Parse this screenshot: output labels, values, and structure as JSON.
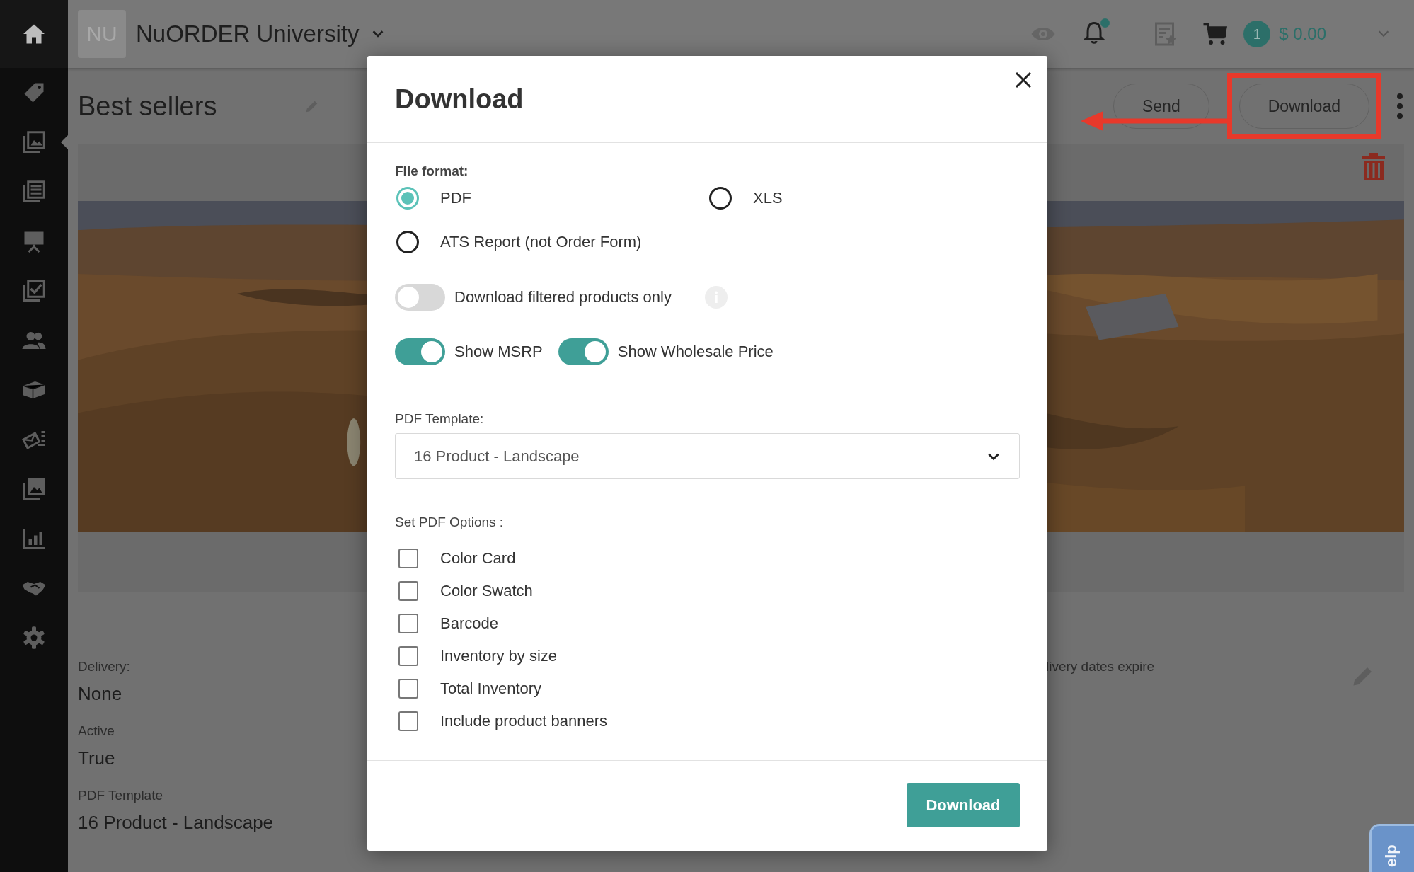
{
  "sidebar": {
    "items": [
      {
        "kind": "home",
        "selected": false
      },
      {
        "kind": "tag",
        "selected": false
      },
      {
        "kind": "catalog",
        "selected": true
      },
      {
        "kind": "list",
        "selected": false
      },
      {
        "kind": "presentation",
        "selected": false
      },
      {
        "kind": "checklist",
        "selected": false
      },
      {
        "kind": "people",
        "selected": false
      },
      {
        "kind": "box",
        "selected": false
      },
      {
        "kind": "mail",
        "selected": false
      },
      {
        "kind": "images",
        "selected": false
      },
      {
        "kind": "chart",
        "selected": false
      },
      {
        "kind": "handshake",
        "selected": false
      },
      {
        "kind": "gear",
        "selected": false
      }
    ]
  },
  "top_bar": {
    "logo_initials": "NU",
    "company": "NuORDER University",
    "cart_count": "1",
    "cart_total": "$ 0.00"
  },
  "page": {
    "title": "Best sellers",
    "buttons": [
      {
        "label": "Send",
        "highlighted": false
      },
      {
        "label": "Download",
        "highlighted": true
      }
    ]
  },
  "details": [
    {
      "label": "Delivery:",
      "value": "None"
    },
    {
      "label": "Active",
      "value": "True"
    },
    {
      "label": "PDF Template",
      "value": "16 Product - Landscape"
    }
  ],
  "expiry_note": "livery dates expire",
  "help_tab": "elp",
  "modal": {
    "title": "Download",
    "file_format_label": "File format:",
    "formats": [
      {
        "label": "PDF",
        "selected": true
      },
      {
        "label": "XLS",
        "selected": false
      },
      {
        "label": "ATS Report (not Order Form)",
        "selected": false
      }
    ],
    "toggles": [
      {
        "label": "Download filtered products only",
        "on": false,
        "info": true
      },
      {
        "label": "Show MSRP",
        "on": true,
        "info": false
      },
      {
        "label": "Show Wholesale Price",
        "on": true,
        "info": false
      }
    ],
    "template_label": "PDF Template:",
    "template_value": "16 Product - Landscape",
    "options_label": "Set PDF Options :",
    "options": [
      {
        "label": "Color Card",
        "checked": false
      },
      {
        "label": "Color Swatch",
        "checked": false
      },
      {
        "label": "Barcode",
        "checked": false
      },
      {
        "label": "Inventory by size",
        "checked": false
      },
      {
        "label": "Total Inventory",
        "checked": false
      },
      {
        "label": "Include product banners",
        "checked": false
      }
    ],
    "submit": "Download"
  }
}
